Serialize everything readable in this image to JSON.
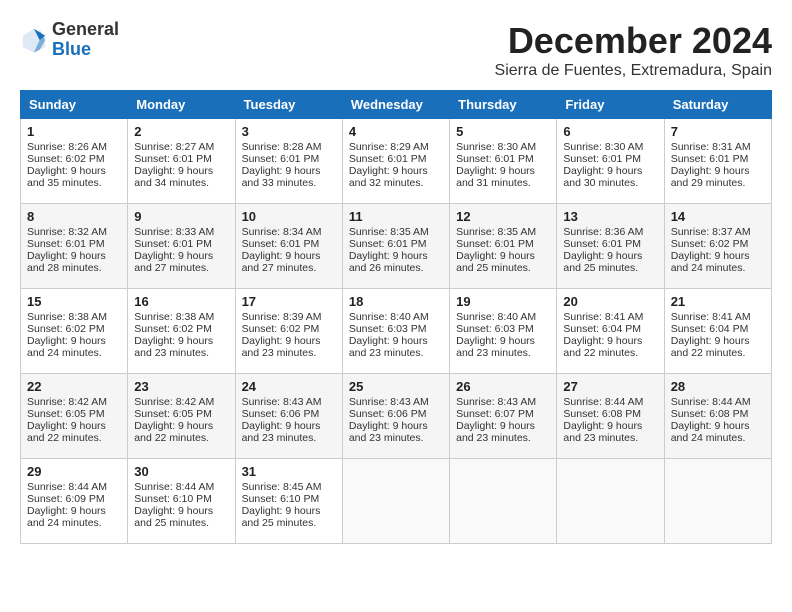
{
  "header": {
    "logo_general": "General",
    "logo_blue": "Blue",
    "month_title": "December 2024",
    "location": "Sierra de Fuentes, Extremadura, Spain"
  },
  "weekdays": [
    "Sunday",
    "Monday",
    "Tuesday",
    "Wednesday",
    "Thursday",
    "Friday",
    "Saturday"
  ],
  "weeks": [
    [
      {
        "day": "1",
        "rise": "Sunrise: 8:26 AM",
        "set": "Sunset: 6:02 PM",
        "daylight": "Daylight: 9 hours and 35 minutes."
      },
      {
        "day": "2",
        "rise": "Sunrise: 8:27 AM",
        "set": "Sunset: 6:01 PM",
        "daylight": "Daylight: 9 hours and 34 minutes."
      },
      {
        "day": "3",
        "rise": "Sunrise: 8:28 AM",
        "set": "Sunset: 6:01 PM",
        "daylight": "Daylight: 9 hours and 33 minutes."
      },
      {
        "day": "4",
        "rise": "Sunrise: 8:29 AM",
        "set": "Sunset: 6:01 PM",
        "daylight": "Daylight: 9 hours and 32 minutes."
      },
      {
        "day": "5",
        "rise": "Sunrise: 8:30 AM",
        "set": "Sunset: 6:01 PM",
        "daylight": "Daylight: 9 hours and 31 minutes."
      },
      {
        "day": "6",
        "rise": "Sunrise: 8:30 AM",
        "set": "Sunset: 6:01 PM",
        "daylight": "Daylight: 9 hours and 30 minutes."
      },
      {
        "day": "7",
        "rise": "Sunrise: 8:31 AM",
        "set": "Sunset: 6:01 PM",
        "daylight": "Daylight: 9 hours and 29 minutes."
      }
    ],
    [
      {
        "day": "8",
        "rise": "Sunrise: 8:32 AM",
        "set": "Sunset: 6:01 PM",
        "daylight": "Daylight: 9 hours and 28 minutes."
      },
      {
        "day": "9",
        "rise": "Sunrise: 8:33 AM",
        "set": "Sunset: 6:01 PM",
        "daylight": "Daylight: 9 hours and 27 minutes."
      },
      {
        "day": "10",
        "rise": "Sunrise: 8:34 AM",
        "set": "Sunset: 6:01 PM",
        "daylight": "Daylight: 9 hours and 27 minutes."
      },
      {
        "day": "11",
        "rise": "Sunrise: 8:35 AM",
        "set": "Sunset: 6:01 PM",
        "daylight": "Daylight: 9 hours and 26 minutes."
      },
      {
        "day": "12",
        "rise": "Sunrise: 8:35 AM",
        "set": "Sunset: 6:01 PM",
        "daylight": "Daylight: 9 hours and 25 minutes."
      },
      {
        "day": "13",
        "rise": "Sunrise: 8:36 AM",
        "set": "Sunset: 6:01 PM",
        "daylight": "Daylight: 9 hours and 25 minutes."
      },
      {
        "day": "14",
        "rise": "Sunrise: 8:37 AM",
        "set": "Sunset: 6:02 PM",
        "daylight": "Daylight: 9 hours and 24 minutes."
      }
    ],
    [
      {
        "day": "15",
        "rise": "Sunrise: 8:38 AM",
        "set": "Sunset: 6:02 PM",
        "daylight": "Daylight: 9 hours and 24 minutes."
      },
      {
        "day": "16",
        "rise": "Sunrise: 8:38 AM",
        "set": "Sunset: 6:02 PM",
        "daylight": "Daylight: 9 hours and 23 minutes."
      },
      {
        "day": "17",
        "rise": "Sunrise: 8:39 AM",
        "set": "Sunset: 6:02 PM",
        "daylight": "Daylight: 9 hours and 23 minutes."
      },
      {
        "day": "18",
        "rise": "Sunrise: 8:40 AM",
        "set": "Sunset: 6:03 PM",
        "daylight": "Daylight: 9 hours and 23 minutes."
      },
      {
        "day": "19",
        "rise": "Sunrise: 8:40 AM",
        "set": "Sunset: 6:03 PM",
        "daylight": "Daylight: 9 hours and 23 minutes."
      },
      {
        "day": "20",
        "rise": "Sunrise: 8:41 AM",
        "set": "Sunset: 6:04 PM",
        "daylight": "Daylight: 9 hours and 22 minutes."
      },
      {
        "day": "21",
        "rise": "Sunrise: 8:41 AM",
        "set": "Sunset: 6:04 PM",
        "daylight": "Daylight: 9 hours and 22 minutes."
      }
    ],
    [
      {
        "day": "22",
        "rise": "Sunrise: 8:42 AM",
        "set": "Sunset: 6:05 PM",
        "daylight": "Daylight: 9 hours and 22 minutes."
      },
      {
        "day": "23",
        "rise": "Sunrise: 8:42 AM",
        "set": "Sunset: 6:05 PM",
        "daylight": "Daylight: 9 hours and 22 minutes."
      },
      {
        "day": "24",
        "rise": "Sunrise: 8:43 AM",
        "set": "Sunset: 6:06 PM",
        "daylight": "Daylight: 9 hours and 23 minutes."
      },
      {
        "day": "25",
        "rise": "Sunrise: 8:43 AM",
        "set": "Sunset: 6:06 PM",
        "daylight": "Daylight: 9 hours and 23 minutes."
      },
      {
        "day": "26",
        "rise": "Sunrise: 8:43 AM",
        "set": "Sunset: 6:07 PM",
        "daylight": "Daylight: 9 hours and 23 minutes."
      },
      {
        "day": "27",
        "rise": "Sunrise: 8:44 AM",
        "set": "Sunset: 6:08 PM",
        "daylight": "Daylight: 9 hours and 23 minutes."
      },
      {
        "day": "28",
        "rise": "Sunrise: 8:44 AM",
        "set": "Sunset: 6:08 PM",
        "daylight": "Daylight: 9 hours and 24 minutes."
      }
    ],
    [
      {
        "day": "29",
        "rise": "Sunrise: 8:44 AM",
        "set": "Sunset: 6:09 PM",
        "daylight": "Daylight: 9 hours and 24 minutes."
      },
      {
        "day": "30",
        "rise": "Sunrise: 8:44 AM",
        "set": "Sunset: 6:10 PM",
        "daylight": "Daylight: 9 hours and 25 minutes."
      },
      {
        "day": "31",
        "rise": "Sunrise: 8:45 AM",
        "set": "Sunset: 6:10 PM",
        "daylight": "Daylight: 9 hours and 25 minutes."
      },
      null,
      null,
      null,
      null
    ]
  ]
}
